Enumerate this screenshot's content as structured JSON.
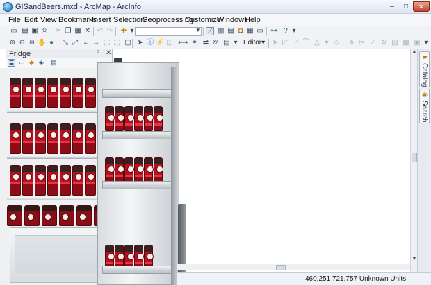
{
  "window": {
    "title": "GISandBeers.mxd - ArcMap - ArcInfo",
    "controls": {
      "minimize": "–",
      "maximize": "□",
      "close": "✕"
    }
  },
  "menu": [
    "File",
    "Edit",
    "View",
    "Bookmarks",
    "Insert",
    "Selection",
    "Geoprocessing",
    "Customize",
    "Windows",
    "Help"
  ],
  "toolbar": {
    "scale_value": "",
    "editor_label": "Editor▾"
  },
  "toc_panel": {
    "title": "Fridge",
    "pin_glyph": "ᵖ",
    "close_glyph": "✕"
  },
  "right_dock": {
    "tabs": [
      "Catalog",
      "Search"
    ]
  },
  "status": {
    "coordinates": "460,251  721,757 Unknown Units"
  },
  "map_scene": {
    "subject": "refrigerator-stocked-with-red-beer-cans"
  }
}
